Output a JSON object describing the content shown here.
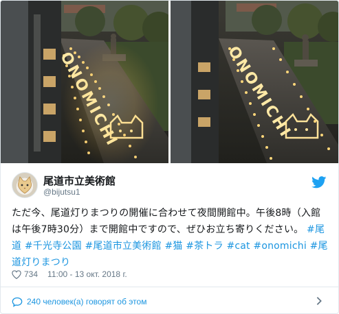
{
  "tweet": {
    "display_name": "尾道市立美術館",
    "handle": "@bijutsu1",
    "text_parts": [
      "ただ今、尾道灯りまつりの開催に合わせて夜間開館中。午後8時（入館は午後7時30分）まで開館中ですので、ぜひお立ち寄りください。 "
    ],
    "hashtags": [
      "#尾道",
      "#千光寺公園",
      "#尾道市立美術館",
      "#猫",
      "#茶トラ",
      "#cat",
      "#onomichi",
      "#尾道灯りまつり"
    ],
    "likes": "734",
    "timestamp": "11:00 - 13 окт. 2018 г.",
    "talking_about": "240 человек(а) говорят об этом"
  },
  "photos": [
    {
      "candle_text": "ONOMICHI"
    },
    {
      "candle_text": "ONOMICHI"
    }
  ],
  "icons": {
    "brand": "twitter-bird-icon",
    "like": "heart-icon",
    "conversation": "speech-bubble-icon",
    "more": "chevron-right-icon"
  },
  "colors": {
    "link": "#1b95e0",
    "muted": "#657786",
    "border": "#e1e8ed"
  }
}
